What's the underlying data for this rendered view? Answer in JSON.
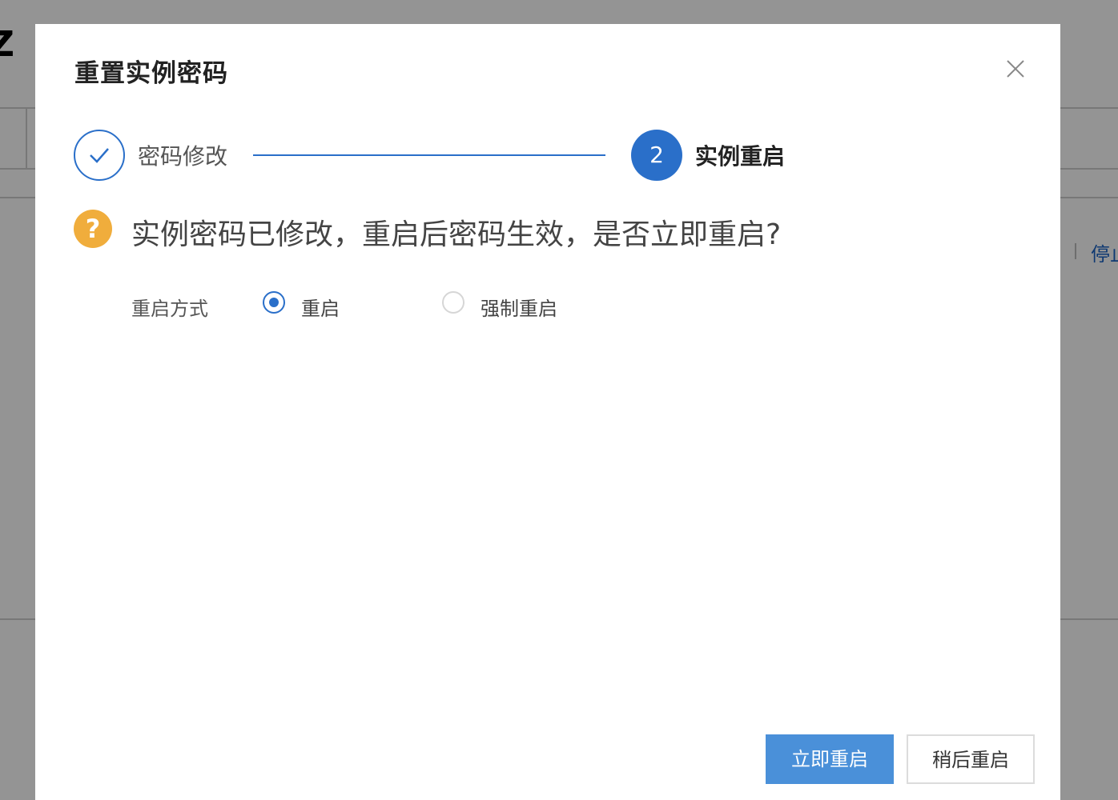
{
  "background": {
    "title_fragment": "Z",
    "stop_link": "停止"
  },
  "dialog": {
    "title": "重置实例密码",
    "close_icon": "close-icon"
  },
  "steps": [
    {
      "label": "密码修改",
      "state": "done",
      "icon": "check-icon"
    },
    {
      "label": "实例重启",
      "state": "active",
      "number": "2"
    }
  ],
  "question": {
    "icon": "question-icon",
    "text": "实例密码已修改，重启后密码生效，是否立即重启?"
  },
  "restart_mode": {
    "label": "重启方式",
    "options": [
      {
        "label": "重启",
        "checked": true
      },
      {
        "label": "强制重启",
        "checked": false
      }
    ]
  },
  "footer": {
    "restart_now": "立即重启",
    "restart_later": "稍后重启"
  },
  "colors": {
    "primary": "#2a6fc9",
    "button_primary": "#4a90d9",
    "warning": "#f0ad3c"
  }
}
